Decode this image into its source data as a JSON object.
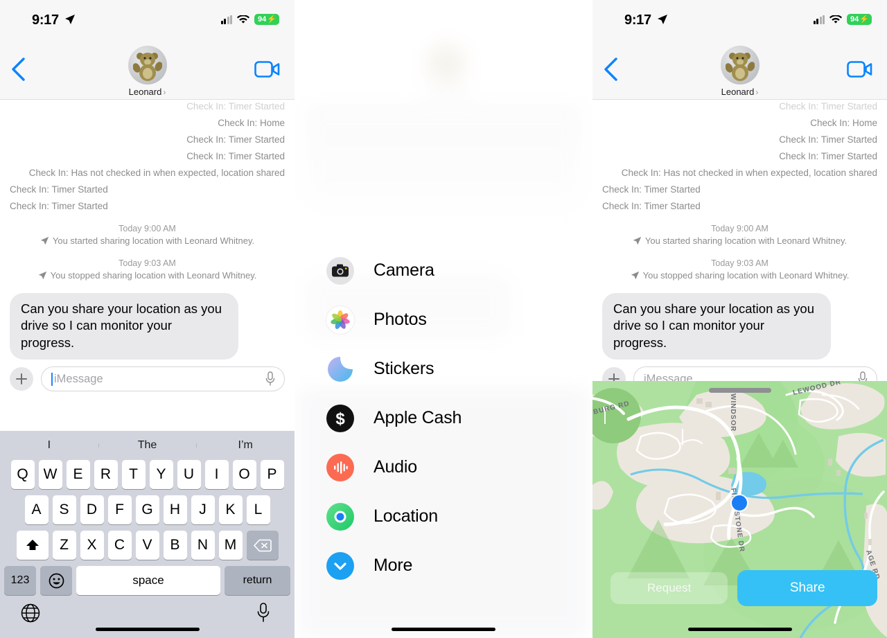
{
  "status_bar": {
    "time": "9:17",
    "location_arrow_icon": "location-arrow-icon",
    "cellular_icon": "cellular-bars-icon",
    "wifi_icon": "wifi-icon",
    "battery_level": "94",
    "battery_charging_glyph": "⚡"
  },
  "nav": {
    "back_icon": "chevron-left-icon",
    "contact_name": "Leonard",
    "disclosure_chevron": "›",
    "facetime_icon": "video-camera-icon",
    "avatar_alt": "teddy-bear-avatar"
  },
  "conversation": {
    "system_messages": [
      {
        "text": "Check In: Timer Started",
        "align": "right",
        "faded": true
      },
      {
        "text": "Check In: Home",
        "align": "right",
        "faded": false
      },
      {
        "text": "Check In: Timer Started",
        "align": "right",
        "faded": false
      },
      {
        "text": "Check In: Timer Started",
        "align": "right",
        "faded": false
      },
      {
        "text": "Check In: Has not checked in when expected, location shared",
        "align": "right",
        "faded": false
      },
      {
        "text": "Check In: Timer Started",
        "align": "left",
        "faded": false
      },
      {
        "text": "Check In: Timer Started",
        "align": "left",
        "faded": false
      }
    ],
    "events": [
      {
        "timestamp": "Today 9:00 AM",
        "text": "You started sharing location with Leonard Whitney."
      },
      {
        "timestamp": "Today 9:03 AM",
        "text": "You stopped sharing location with Leonard Whitney."
      }
    ],
    "incoming_bubble": "Can you share your location as you drive so I can monitor your progress."
  },
  "input_bar": {
    "plus_button_label": "+",
    "placeholder": "iMessage",
    "mic_icon": "microphone-icon",
    "plus_icon": "plus-icon"
  },
  "keyboard": {
    "predictions": [
      "I",
      "The",
      "I’m"
    ],
    "row1": [
      "Q",
      "W",
      "E",
      "R",
      "T",
      "Y",
      "U",
      "I",
      "O",
      "P"
    ],
    "row2": [
      "A",
      "S",
      "D",
      "F",
      "G",
      "H",
      "J",
      "K",
      "L"
    ],
    "row3": [
      "Z",
      "X",
      "C",
      "V",
      "B",
      "N",
      "M"
    ],
    "shift_icon": "shift-arrow-icon",
    "delete_icon": "backspace-icon",
    "numeric_key": "123",
    "emoji_icon": "emoji-smiley-icon",
    "space_key": "space",
    "return_key": "return",
    "globe_icon": "globe-icon",
    "dictation_icon": "microphone-icon",
    "home_indicator": "home-indicator"
  },
  "app_menu": {
    "items": [
      {
        "label": "Camera",
        "icon": "camera-icon",
        "color": "#e3e3e5"
      },
      {
        "label": "Photos",
        "icon": "photos-icon",
        "color": "#ffffff"
      },
      {
        "label": "Stickers",
        "icon": "stickers-icon",
        "color": "#a8b4f5"
      },
      {
        "label": "Apple Cash",
        "icon": "apple-cash-icon",
        "color": "#111111"
      },
      {
        "label": "Audio",
        "icon": "audio-wave-icon",
        "color": "#fc6a52"
      },
      {
        "label": "Location",
        "icon": "location-ring-icon",
        "color": "#3ad46e"
      },
      {
        "label": "More",
        "icon": "chevron-down-icon",
        "color": "#1ba0f2"
      }
    ]
  },
  "map": {
    "street_labels": [
      "BURG RD",
      "WINDSOR",
      "LEWOOD DR",
      "FIELDSTONE DR",
      "AGE RD"
    ],
    "user_dot": "current-location-dot",
    "request_button": "Request",
    "share_button": "Share",
    "grabber": "sheet-grabber",
    "colors": {
      "share_accent": "#35c1f5",
      "park_green": "#aee1a0",
      "road_white": "#ffffff",
      "water_blue": "#72cbe8",
      "dot_blue": "#1b7ef5"
    }
  }
}
